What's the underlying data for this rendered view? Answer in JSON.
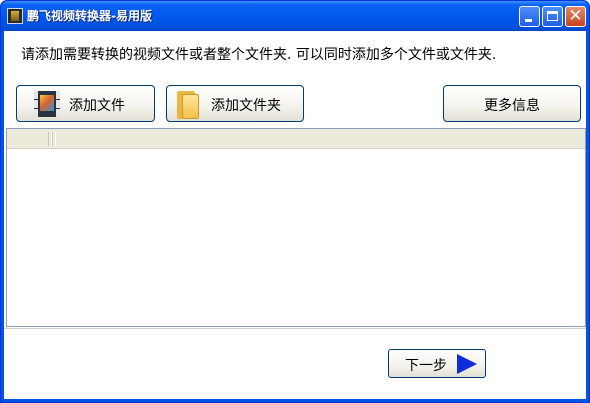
{
  "window": {
    "title": "鹏飞视频转换器-易用版",
    "controls": {
      "close_glyph": "✕"
    }
  },
  "instruction": "请添加需要转换的视频文件或者整个文件夹.  可以同时添加多个文件或文件夹.",
  "toolbar": {
    "add_file_label": "添加文件",
    "add_folder_label": "添加文件夹",
    "more_info_label": "更多信息"
  },
  "footer": {
    "next_label": "下一步"
  },
  "icons": {
    "app": "film-reel-icon",
    "add_file": "film-icon",
    "add_folder": "folder-icon",
    "next": "play-arrow-icon"
  },
  "colors": {
    "titlebar": "#0058ee",
    "arrow": "#0e2cd8",
    "button_border": "#003c74"
  }
}
